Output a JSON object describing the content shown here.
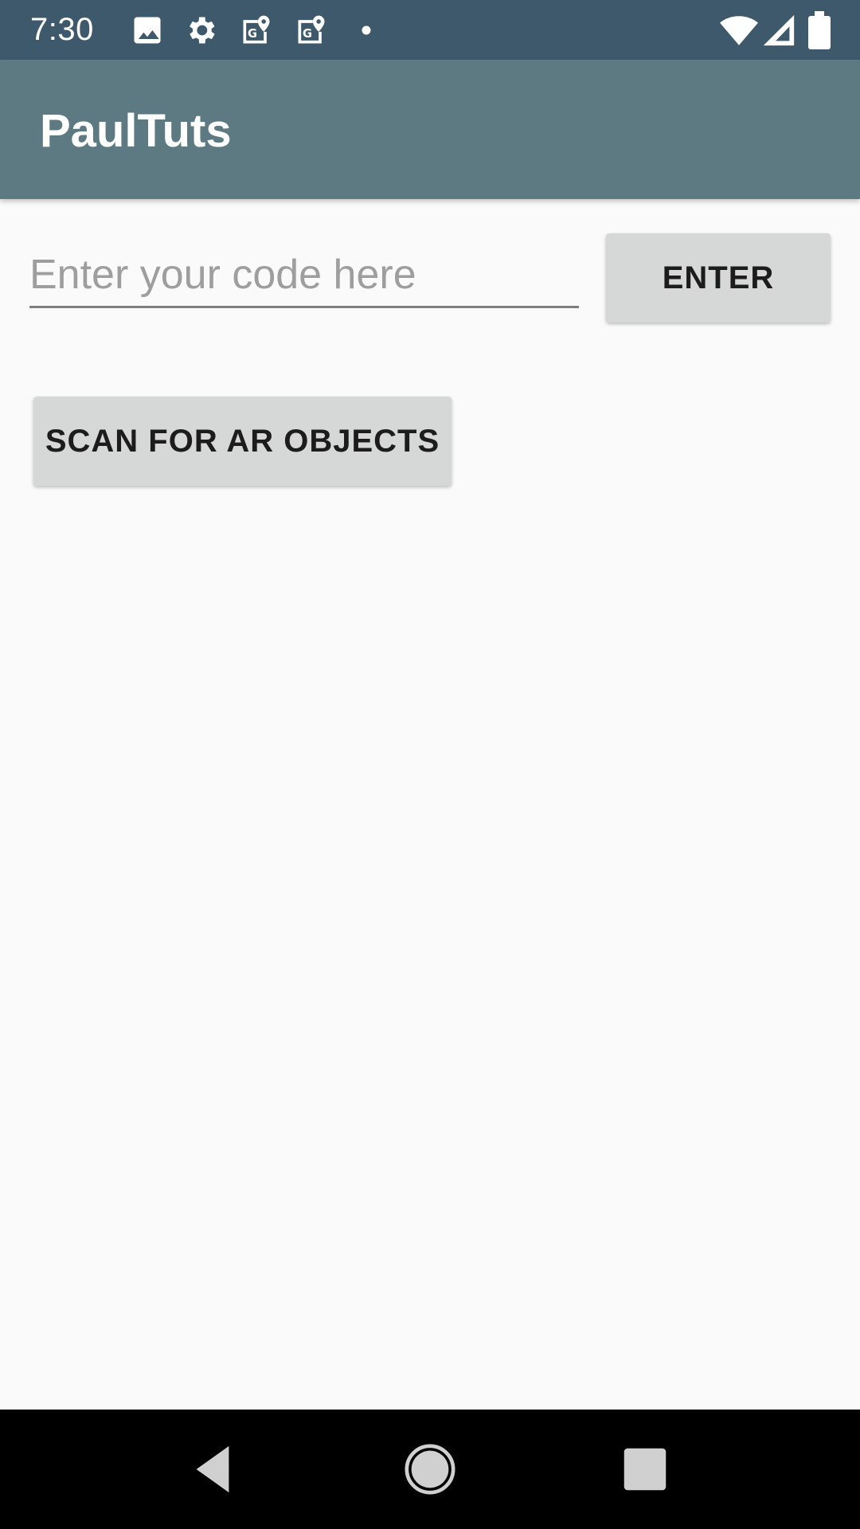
{
  "status_bar": {
    "time": "7:30",
    "icons": [
      "image-icon",
      "settings-gear-icon",
      "maps-icon",
      "maps-icon",
      "notification-dot-icon",
      "wifi-icon",
      "cellular-signal-icon",
      "battery-icon"
    ],
    "background": "#3e596b"
  },
  "app_bar": {
    "title": "PaulTuts",
    "background": "#5d7a82"
  },
  "code_input": {
    "value": "",
    "placeholder": "Enter your code here"
  },
  "buttons": {
    "enter_label": "ENTER",
    "scan_label": "SCAN FOR AR OBJECTS"
  },
  "nav_bar": {
    "items": [
      "back-icon",
      "home-icon",
      "recents-icon"
    ]
  }
}
